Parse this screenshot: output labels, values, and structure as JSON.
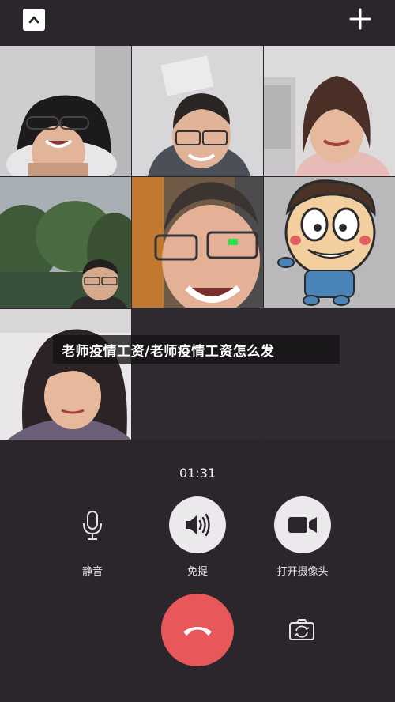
{
  "header": {
    "collapse_icon": "chevron-up-icon",
    "add_icon": "plus-icon"
  },
  "participants": [
    {
      "id": "p1",
      "kind": "video"
    },
    {
      "id": "p2",
      "kind": "video"
    },
    {
      "id": "p3",
      "kind": "video"
    },
    {
      "id": "p4",
      "kind": "video"
    },
    {
      "id": "p5",
      "kind": "video"
    },
    {
      "id": "p6",
      "kind": "cartoon-avatar"
    },
    {
      "id": "p7",
      "kind": "video"
    }
  ],
  "caption": {
    "text": "老师疫情工资/老师疫情工资怎么发"
  },
  "call": {
    "duration": "01:31"
  },
  "controls": {
    "mute_label": "静音",
    "speaker_label": "免提",
    "camera_label": "打开摄像头"
  },
  "colors": {
    "hangup": "#e8585a",
    "background": "#2a262b"
  }
}
